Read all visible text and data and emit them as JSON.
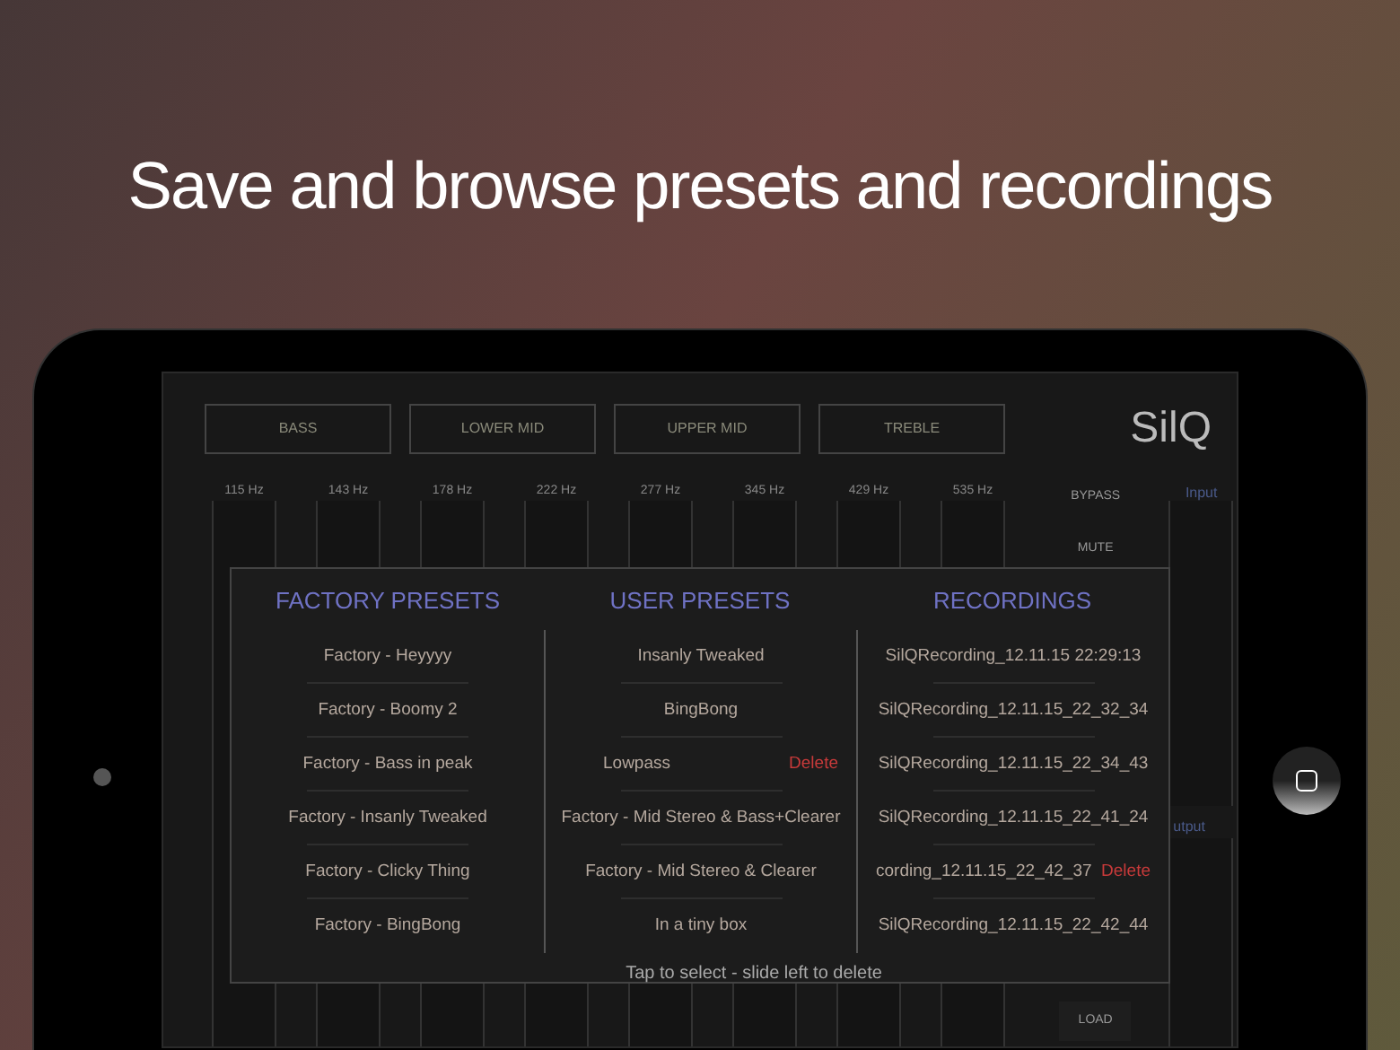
{
  "headline": "Save and browse presets and recordings",
  "app": {
    "logo": "SilQ",
    "bands": [
      "BASS",
      "LOWER MID",
      "UPPER MID",
      "TREBLE"
    ],
    "frequencies": [
      "115 Hz",
      "143 Hz",
      "178 Hz",
      "222 Hz",
      "277 Hz",
      "345 Hz",
      "429 Hz",
      "535 Hz"
    ],
    "controls": [
      "BYPASS",
      "MUTE"
    ],
    "input_label": "Input",
    "output_label": "utput",
    "load_button": "LOAD"
  },
  "dialog": {
    "columns": [
      {
        "title": "FACTORY PRESETS",
        "items": [
          {
            "label": "Factory - Heyyyy"
          },
          {
            "label": "Factory - Boomy 2"
          },
          {
            "label": "Factory - Bass in peak"
          },
          {
            "label": "Factory - Insanly Tweaked"
          },
          {
            "label": "Factory - Clicky Thing"
          },
          {
            "label": "Factory - BingBong"
          }
        ]
      },
      {
        "title": "USER PRESETS",
        "items": [
          {
            "label": "Insanly Tweaked"
          },
          {
            "label": "BingBong"
          },
          {
            "label": "Lowpass",
            "delete": "Delete"
          },
          {
            "label": "Factory - Mid Stereo & Bass+Clearer"
          },
          {
            "label": "Factory - Mid Stereo & Clearer"
          },
          {
            "label": "In a tiny box"
          }
        ]
      },
      {
        "title": "RECORDINGS",
        "items": [
          {
            "label": "SilQRecording_12.11.15 22:29:13"
          },
          {
            "label": "SilQRecording_12.11.15_22_32_34"
          },
          {
            "label": "SilQRecording_12.11.15_22_34_43"
          },
          {
            "label": "SilQRecording_12.11.15_22_41_24"
          },
          {
            "label": "cording_12.11.15_22_42_37",
            "delete": "Delete"
          },
          {
            "label": "SilQRecording_12.11.15_22_42_44"
          }
        ]
      }
    ],
    "hint": "Tap to select - slide left to delete"
  }
}
